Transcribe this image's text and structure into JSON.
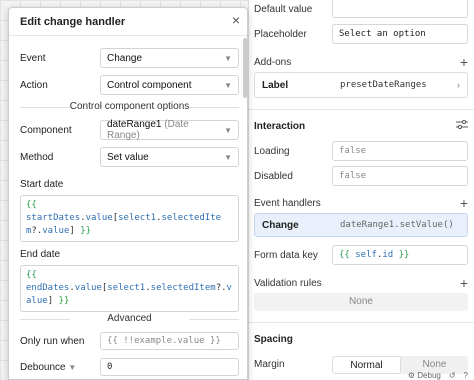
{
  "inspector": {
    "default_value_label": "Default value",
    "placeholder_label": "Placeholder",
    "placeholder_value": "Select an option",
    "addons_label": "Add-ons",
    "addon_key": "Label",
    "addon_value": "presetDateRanges",
    "interaction_label": "Interaction",
    "loading_label": "Loading",
    "loading_value": "false",
    "disabled_label": "Disabled",
    "disabled_value": "false",
    "event_handlers_label": "Event handlers",
    "handler_event": "Change",
    "handler_action": "dateRange1.setValue()",
    "form_data_key_label": "Form data key",
    "form_data_key_value": "{{ self.id }}",
    "validation_label": "Validation rules",
    "validation_value": "None",
    "spacing_label": "Spacing",
    "margin_label": "Margin",
    "margin_options": [
      "Normal",
      "None"
    ],
    "margin_selected": "Normal",
    "debug_label": "Debug"
  },
  "modal": {
    "title": "Edit change handler",
    "event_label": "Event",
    "event_value": "Change",
    "action_label": "Action",
    "action_value": "Control component",
    "options_title": "Control component options",
    "component_label": "Component",
    "component_value": "dateRange1",
    "component_hint": "(Date Range)",
    "method_label": "Method",
    "method_value": "Set value",
    "start_dates_label": "Start date",
    "end_dates_label": "End date",
    "advanced_title": "Advanced",
    "only_run_label": "Only run when",
    "only_run_placeholder": "{{ !!example.value }}",
    "debounce_label": "Debounce",
    "debounce_value": "0"
  },
  "colors": {
    "template_brace": "#2a9d4b",
    "identifier": "#2f6fb3"
  }
}
